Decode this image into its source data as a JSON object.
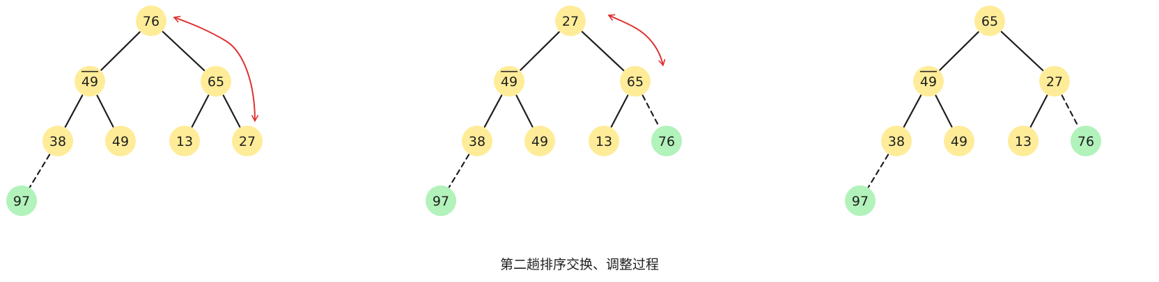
{
  "caption": "第二趟排序交换、调整过程",
  "colors": {
    "heap_node": "#ffec99",
    "sorted_node": "#b2f2bb",
    "edge": "#1e1e1e",
    "swap_arrow": "#e03131"
  },
  "trees": [
    {
      "nodes": [
        {
          "id": "n0",
          "label": "76",
          "state": "heap"
        },
        {
          "id": "n1",
          "label": "49",
          "state": "heap",
          "overline": true
        },
        {
          "id": "n2",
          "label": "65",
          "state": "heap"
        },
        {
          "id": "n3",
          "label": "38",
          "state": "heap"
        },
        {
          "id": "n4",
          "label": "49",
          "state": "heap"
        },
        {
          "id": "n5",
          "label": "13",
          "state": "heap"
        },
        {
          "id": "n6",
          "label": "27",
          "state": "heap"
        },
        {
          "id": "n7",
          "label": "97",
          "state": "sorted"
        }
      ],
      "edges": [
        {
          "from": "n0",
          "to": "n1",
          "style": "solid"
        },
        {
          "from": "n0",
          "to": "n2",
          "style": "solid"
        },
        {
          "from": "n1",
          "to": "n3",
          "style": "solid"
        },
        {
          "from": "n1",
          "to": "n4",
          "style": "solid"
        },
        {
          "from": "n2",
          "to": "n5",
          "style": "solid"
        },
        {
          "from": "n2",
          "to": "n6",
          "style": "solid"
        },
        {
          "from": "n3",
          "to": "n7",
          "style": "dashed"
        }
      ],
      "swap": {
        "between": [
          "n0",
          "n6"
        ]
      }
    },
    {
      "nodes": [
        {
          "id": "n0",
          "label": "27",
          "state": "heap"
        },
        {
          "id": "n1",
          "label": "49",
          "state": "heap",
          "overline": true
        },
        {
          "id": "n2",
          "label": "65",
          "state": "heap"
        },
        {
          "id": "n3",
          "label": "38",
          "state": "heap"
        },
        {
          "id": "n4",
          "label": "49",
          "state": "heap"
        },
        {
          "id": "n5",
          "label": "13",
          "state": "heap"
        },
        {
          "id": "n6",
          "label": "76",
          "state": "sorted"
        },
        {
          "id": "n7",
          "label": "97",
          "state": "sorted"
        }
      ],
      "edges": [
        {
          "from": "n0",
          "to": "n1",
          "style": "solid"
        },
        {
          "from": "n0",
          "to": "n2",
          "style": "solid"
        },
        {
          "from": "n1",
          "to": "n3",
          "style": "solid"
        },
        {
          "from": "n1",
          "to": "n4",
          "style": "solid"
        },
        {
          "from": "n2",
          "to": "n5",
          "style": "solid"
        },
        {
          "from": "n2",
          "to": "n6",
          "style": "dashed"
        },
        {
          "from": "n3",
          "to": "n7",
          "style": "dashed"
        }
      ],
      "swap": {
        "between": [
          "n0",
          "n2"
        ]
      }
    },
    {
      "nodes": [
        {
          "id": "n0",
          "label": "65",
          "state": "heap"
        },
        {
          "id": "n1",
          "label": "49",
          "state": "heap",
          "overline": true
        },
        {
          "id": "n2",
          "label": "27",
          "state": "heap"
        },
        {
          "id": "n3",
          "label": "38",
          "state": "heap"
        },
        {
          "id": "n4",
          "label": "49",
          "state": "heap"
        },
        {
          "id": "n5",
          "label": "13",
          "state": "heap"
        },
        {
          "id": "n6",
          "label": "76",
          "state": "sorted"
        },
        {
          "id": "n7",
          "label": "97",
          "state": "sorted"
        }
      ],
      "edges": [
        {
          "from": "n0",
          "to": "n1",
          "style": "solid"
        },
        {
          "from": "n0",
          "to": "n2",
          "style": "solid"
        },
        {
          "from": "n1",
          "to": "n3",
          "style": "solid"
        },
        {
          "from": "n1",
          "to": "n4",
          "style": "solid"
        },
        {
          "from": "n2",
          "to": "n5",
          "style": "solid"
        },
        {
          "from": "n2",
          "to": "n6",
          "style": "dashed"
        },
        {
          "from": "n3",
          "to": "n7",
          "style": "dashed"
        }
      ],
      "swap": null
    }
  ]
}
